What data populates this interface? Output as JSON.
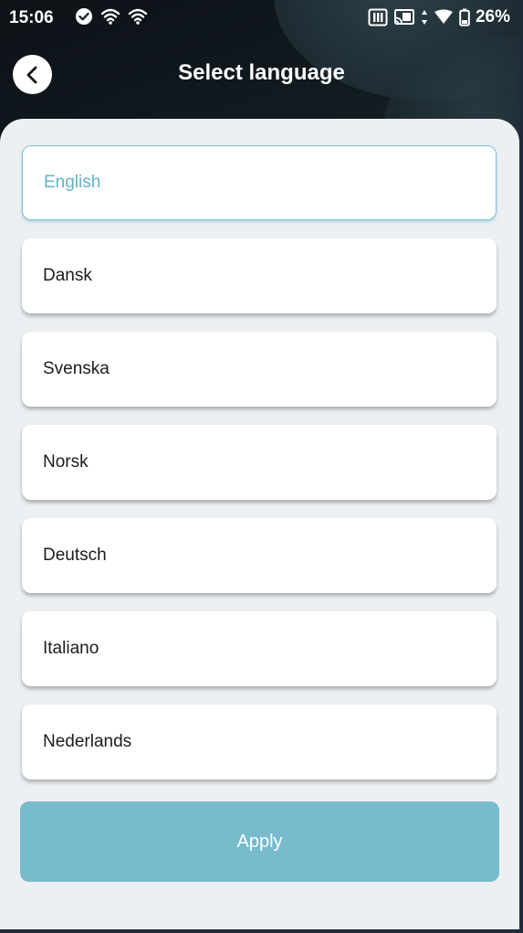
{
  "status_bar": {
    "time": "15:06",
    "battery": "26%",
    "icons": [
      "check-circle-icon",
      "wifi-icon",
      "wifi-icon",
      "nfc-icon",
      "cast-icon",
      "data-arrows-icon",
      "signal-icon",
      "battery-icon"
    ]
  },
  "header": {
    "title": "Select language",
    "back_icon": "chevron-left-icon"
  },
  "languages": {
    "items": [
      {
        "label": "English",
        "selected": true
      },
      {
        "label": "Dansk",
        "selected": false
      },
      {
        "label": "Svenska",
        "selected": false
      },
      {
        "label": "Norsk",
        "selected": false
      },
      {
        "label": "Deutsch",
        "selected": false
      },
      {
        "label": "Italiano",
        "selected": false
      },
      {
        "label": "Nederlands",
        "selected": false
      }
    ]
  },
  "actions": {
    "apply_label": "Apply"
  },
  "colors": {
    "accent": "#77bbcd",
    "selected_text": "#62b3c9",
    "panel_background": "#edf0f3"
  }
}
